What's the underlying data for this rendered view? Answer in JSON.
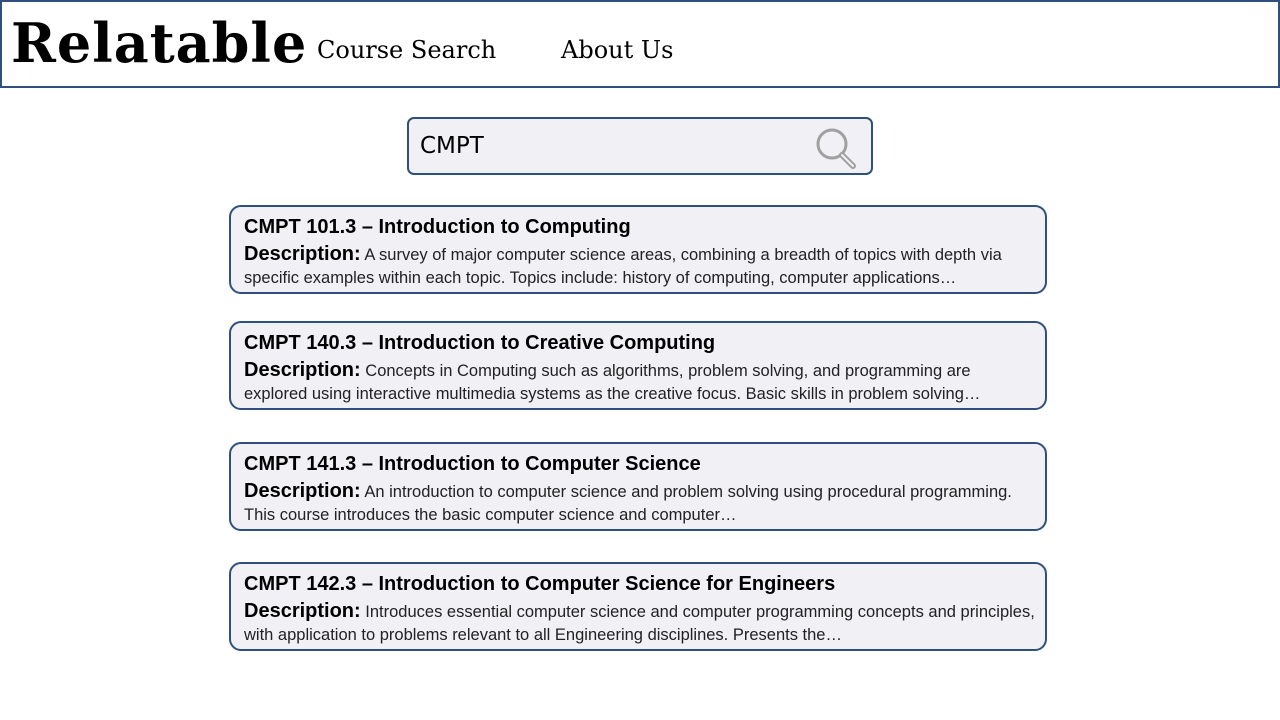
{
  "header": {
    "logo": "Relatable",
    "nav": [
      {
        "label": "Course Search"
      },
      {
        "label": "About Us"
      }
    ]
  },
  "search": {
    "value": "CMPT",
    "icon": "magnifier-icon"
  },
  "results": [
    {
      "title": "CMPT 101.3 – Introduction to Computing",
      "desc_label": "Description:",
      "description": "A survey of major computer science areas, combining a breadth of topics with depth via specific examples within each topic. Topics include: history of computing, computer applications…"
    },
    {
      "title": "CMPT 140.3 – Introduction to Creative Computing",
      "desc_label": "Description:",
      "description": "Concepts in Computing such as algorithms, problem solving, and programming are explored using interactive multimedia systems as the creative focus. Basic skills in problem solving…"
    },
    {
      "title": "CMPT 141.3 – Introduction to Computer Science",
      "desc_label": "Description:",
      "description": "An introduction to computer science and problem solving using procedural programming. This course introduces the basic computer science and computer…"
    },
    {
      "title": "CMPT 142.3 – Introduction to Computer Science for Engineers",
      "desc_label": "Description:",
      "description": "Introduces essential computer science and computer programming concepts and principles, with application to problems relevant to all Engineering disciplines. Presents the…"
    }
  ],
  "colors": {
    "border": "#2f4f7f",
    "card_bg": "#f0f0f5",
    "icon": "#a0a0a0"
  }
}
